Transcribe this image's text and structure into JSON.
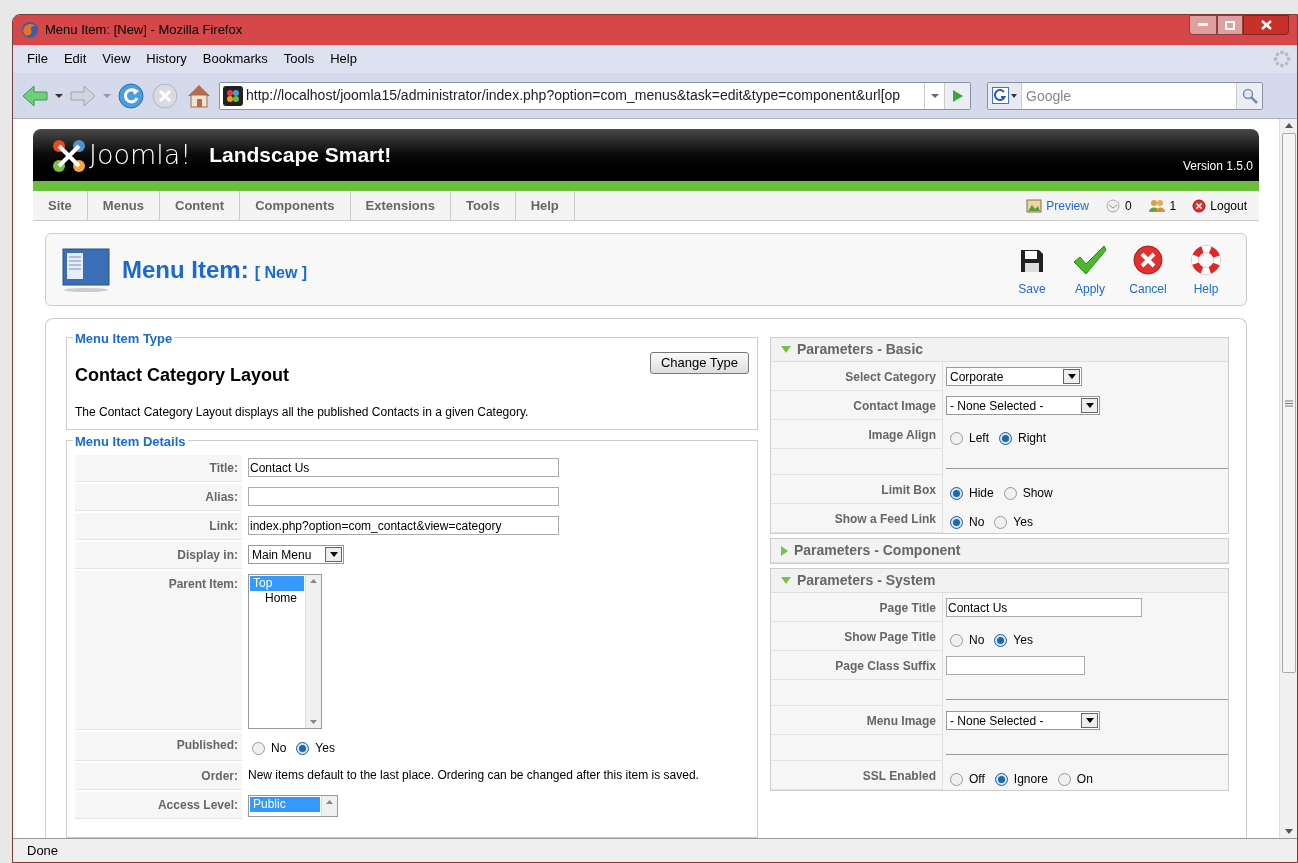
{
  "window": {
    "title": "Menu Item: [New] - Mozilla Firefox"
  },
  "menu_bar": [
    "File",
    "Edit",
    "View",
    "History",
    "Bookmarks",
    "Tools",
    "Help"
  ],
  "navigation": {
    "address": "http://localhost/joomla15/administrator/index.php?option=com_menus&task=edit&type=component&url[op",
    "search": {
      "placeholder": "Google"
    }
  },
  "header": {
    "logo": "Joomla!",
    "site_name": "Landscape Smart!",
    "version": "Version 1.5.0"
  },
  "admin_menu": [
    "Site",
    "Menus",
    "Content",
    "Components",
    "Extensions",
    "Tools",
    "Help"
  ],
  "status_links": [
    {
      "kind": "preview",
      "label": "Preview"
    },
    {
      "kind": "messages",
      "label": "0"
    },
    {
      "kind": "users",
      "label": "1"
    },
    {
      "kind": "logout",
      "label": "Logout"
    }
  ],
  "toolbar": {
    "title": "Menu Item:",
    "subtitle": "[ New ]",
    "buttons": [
      {
        "kind": "save",
        "label": "Save"
      },
      {
        "kind": "apply",
        "label": "Apply"
      },
      {
        "kind": "cancel",
        "label": "Cancel"
      },
      {
        "kind": "help",
        "label": "Help"
      }
    ]
  },
  "menu_item_type": {
    "legend": "Menu Item Type",
    "button": "Change Type",
    "heading": "Contact Category Layout",
    "description": "The Contact Category Layout displays all the published Contacts in a given Category."
  },
  "menu_item_details": {
    "legend": "Menu Item Details",
    "rows": [
      {
        "kind": "text",
        "label": "Title:",
        "value": "Contact Us"
      },
      {
        "kind": "text",
        "label": "Alias:",
        "value": ""
      },
      {
        "kind": "text",
        "label": "Link:",
        "value": "index.php?option=com_contact&view=category"
      },
      {
        "kind": "select",
        "label": "Display in:",
        "value": "Main Menu"
      },
      {
        "kind": "listbox",
        "label": "Parent Item:",
        "items": [
          {
            "label": "Top",
            "selected": true,
            "children": [
              {
                "label": "Home",
                "selected": false
              }
            ]
          }
        ]
      },
      {
        "kind": "radio",
        "label": "Published:",
        "options": [
          {
            "label": "No",
            "selected": false
          },
          {
            "label": "Yes",
            "selected": true
          }
        ]
      },
      {
        "kind": "note",
        "label": "Order:",
        "value": "New items default to the last place. Ordering can be changed after this item is saved."
      },
      {
        "kind": "listbox_cut",
        "label": "Access Level:",
        "items": [
          {
            "label": "Public",
            "selected": true
          }
        ]
      }
    ]
  },
  "parameter_panels": [
    {
      "title": "Parameters - Basic",
      "expanded": true,
      "rows": [
        {
          "kind": "select",
          "label": "Select Category",
          "value": "Corporate"
        },
        {
          "kind": "select",
          "label": "Contact Image",
          "value": "- None Selected -"
        },
        {
          "kind": "radio",
          "label": "Image Align",
          "options": [
            {
              "label": "Left",
              "selected": false
            },
            {
              "label": "Right",
              "selected": true
            }
          ]
        },
        {
          "kind": "spacer"
        },
        {
          "kind": "radio",
          "label": "Limit Box",
          "options": [
            {
              "label": "Hide",
              "selected": true
            },
            {
              "label": "Show",
              "selected": false
            }
          ]
        },
        {
          "kind": "radio",
          "label": "Show a Feed Link",
          "options": [
            {
              "label": "No",
              "selected": true
            },
            {
              "label": "Yes",
              "selected": false
            }
          ]
        }
      ]
    },
    {
      "title": "Parameters - Component",
      "expanded": false
    },
    {
      "title": "Parameters - System",
      "expanded": true,
      "rows": [
        {
          "kind": "text",
          "label": "Page Title",
          "value": "Contact Us"
        },
        {
          "kind": "radio",
          "label": "Show Page Title",
          "options": [
            {
              "label": "No",
              "selected": false
            },
            {
              "label": "Yes",
              "selected": true
            }
          ]
        },
        {
          "kind": "text_short",
          "label": "Page Class Suffix",
          "value": ""
        },
        {
          "kind": "spacer"
        },
        {
          "kind": "select",
          "label": "Menu Image",
          "value": "- None Selected -"
        },
        {
          "kind": "spacer"
        },
        {
          "kind": "radio",
          "label": "SSL Enabled",
          "options": [
            {
              "label": "Off",
              "selected": false
            },
            {
              "label": "Ignore",
              "selected": true
            },
            {
              "label": "On",
              "selected": false
            }
          ]
        }
      ]
    }
  ],
  "status_bar": {
    "text": "Done"
  }
}
